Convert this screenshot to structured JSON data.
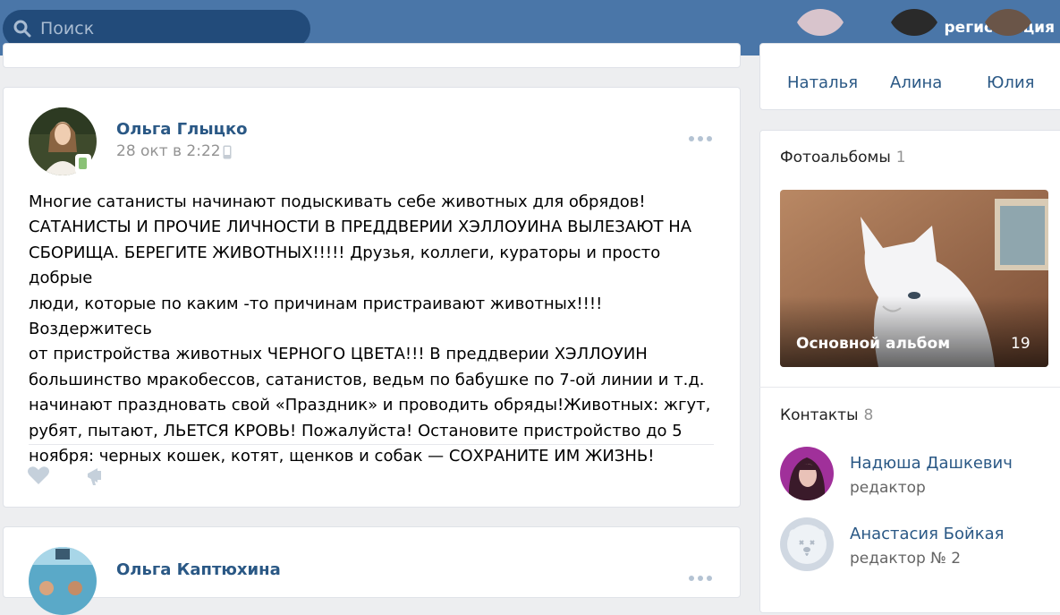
{
  "header": {
    "search_placeholder": "Поиск",
    "register_label": "регистрация"
  },
  "post": {
    "author": "Ольга Глыцко",
    "date": "28 окт в 2:22",
    "text": "Многие сатанисты начинают подыскивать себе животных для обрядов!\nСАТАНИСТЫ И ПРОЧИЕ ЛИЧНОСТИ В ПРЕДДВЕРИИ ХЭЛЛОУИНА ВЫЛЕЗАЮТ НА\nСБОРИЩА. БЕРЕГИТЕ ЖИВОТНЫХ!!!!! Друзья, коллеги, кураторы и просто добрые\nлюди, которые по каким -то причинам пристраивают животных!!!! Воздержитесь\nот пристройства животных ЧЕРНОГО ЦВЕТА!!! В преддверии ХЭЛЛОУИН\nбольшинство мракобессов, сатанистов, ведьм по бабушке по 7-ой линии и т.д.\nначинают праздновать свой «Праздник» и проводить обряды!Животных: жгут,\nрубят, пытают, ЛЬЕТСЯ КРОВЬ! Пожалуйста! Остановите пристройство до 5\nноября: черных кошек, котят, щенков и собак — СОХРАНИТЕ ИМ ЖИЗНЬ!"
  },
  "post2": {
    "author": "Ольга Каптюхина"
  },
  "friends": [
    {
      "name": "Наталья"
    },
    {
      "name": "Алина"
    },
    {
      "name": "Юлия"
    }
  ],
  "albums": {
    "title": "Фотоальбомы",
    "count": "1",
    "items": [
      {
        "name": "Основной альбом",
        "count": "19"
      }
    ]
  },
  "contacts": {
    "title": "Контакты",
    "count": "8",
    "items": [
      {
        "name": "Надюша Дашкевич",
        "role": "редактор"
      },
      {
        "name": "Анастасия Бойкая",
        "role": "редактор № 2"
      }
    ]
  },
  "colors": {
    "header_bg": "#4a76a8",
    "link": "#2a5885",
    "page_bg": "#edeef0"
  }
}
